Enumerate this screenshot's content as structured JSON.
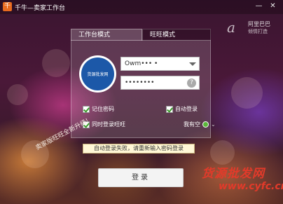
{
  "window": {
    "title": "千牛—卖家工作台",
    "logo_glyph": "千",
    "controls": {
      "minimize": "—",
      "close": "✕"
    }
  },
  "brand": {
    "name": "阿里巴巴",
    "slogan": "倾情打造",
    "logo_glyph": "a"
  },
  "tabs": [
    {
      "label": "工作台模式",
      "active": true
    },
    {
      "label": "旺旺模式",
      "active": false
    }
  ],
  "avatar": {
    "text": "货源批发网"
  },
  "username": {
    "value": "Owm••• •"
  },
  "password": {
    "value": "••••••••",
    "help": "?"
  },
  "options": {
    "remember_password": {
      "label": "记住密码",
      "checked": true
    },
    "auto_login": {
      "label": "自动登录",
      "checked": true
    },
    "login_wangwang": {
      "label": "同时登录旺旺",
      "checked": true
    },
    "status": {
      "label": "我有空",
      "chevron": "⌄"
    }
  },
  "upgrade_note": "卖家版旺旺全新升级!",
  "error_message": "自动登录失败，请重新输入密码登录",
  "login_button": "登录",
  "watermark": {
    "text": "货源批发网",
    "url": "www.cyfc.cn"
  },
  "colors": {
    "accent_error_bg": "#fff7d6",
    "avatar_bg": "#1c58a8",
    "status_online": "#5ab83a",
    "watermark": "#e23a2a"
  }
}
